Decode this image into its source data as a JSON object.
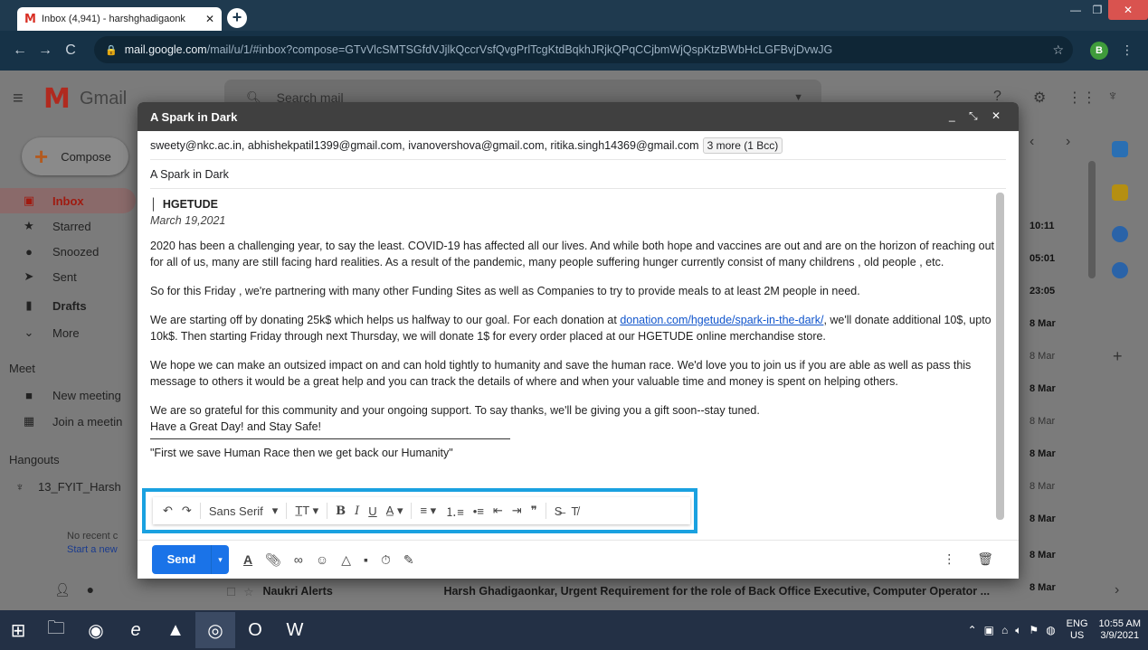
{
  "browser": {
    "tab_title": "Inbox (4,941) - harshghadigaonk",
    "url_host": "mail.google.com",
    "url_path": "/mail/u/1/#inbox?compose=GTvVlcSMTSGfdVJjlkQccrVsfQvgPrlTcgKtdBqkhJRjkQPqCCjbmWjQspKtzBWbHcLGFBvjDvwJG",
    "profile_initial": "B"
  },
  "gmail": {
    "product": "Gmail",
    "search_placeholder": "Search mail",
    "compose_label": "Compose",
    "nav": [
      {
        "label": "Inbox"
      },
      {
        "label": "Starred"
      },
      {
        "label": "Snoozed"
      },
      {
        "label": "Sent"
      },
      {
        "label": "Drafts"
      },
      {
        "label": "More"
      }
    ],
    "meet_heading": "Meet",
    "meet_items": [
      {
        "label": "New meeting"
      },
      {
        "label": "Join a meetin"
      }
    ],
    "hangouts_heading": "Hangouts",
    "hangout_user": "13_FYIT_Harsh",
    "no_recent": "No recent c",
    "start_new": "Start a new",
    "times": [
      "10:11",
      "05:01",
      "23:05",
      "8 Mar",
      "8 Mar",
      "8 Mar",
      "8 Mar",
      "8 Mar",
      "8 Mar",
      "8 Mar",
      "8 Mar",
      "8 Mar"
    ],
    "bottom_row": {
      "sender": "Naukri Alerts",
      "subject": "Harsh Ghadigaonkar, Urgent Requirement for the role of Back Office Executive, Computer Operator ..."
    }
  },
  "compose": {
    "title": "A Spark in Dark",
    "recipients": "sweety@nkc.ac.in, abhishekpatil1399@gmail.com, ivanovershova@gmail.com, ritika.singh14369@gmail.com",
    "more_recipients": "3 more (1 Bcc)",
    "subject": "A Spark in Dark",
    "body": {
      "brand": "HGETUDE",
      "date": "March 19,2021",
      "p1": "2020 has been a challenging year, to say the least. COVID-19 has affected all our lives. And while both hope and vaccines are out and are on the horizon of reaching out for all of us, many are still facing hard realities. As a result of the pandemic, many people suffering hunger currently consist of many childrens , old people , etc.",
      "p2": "So for this Friday , we're partnering with many other Funding Sites as well as Companies to try to provide meals to at least 2M people in need.",
      "p3_before": "We are starting off by donating 25k$ which helps us halfway to our goal. For each donation at ",
      "p3_link": "donation.com/hgetude/spark-in-the-dark/",
      "p3_after": ", we'll donate additional 10$, upto 10k$. Then starting Friday through next Thursday, we will donate 1$ for every order placed at our HGETUDE online merchandise store.",
      "p4": "We hope we can make an outsized impact on and can hold tightly to humanity and save the human race. We'd love you to join us if you are able as well as pass this message to others it would be a great help and you can track the details of where and when your valuable time and money is spent on helping others.",
      "p5a": "We are so grateful for this community and your ongoing support. To say thanks, we'll be giving you a gift soon--stay tuned.",
      "p5b": "Have a Great Day! and Stay Safe!",
      "quote": "\"First we save Human Race then we get back our Humanity\""
    },
    "toolbar_font": "Sans Serif",
    "send_label": "Send"
  },
  "taskbar": {
    "lang_top": "ENG",
    "lang_bottom": "US",
    "time": "10:55 AM",
    "date": "3/9/2021"
  },
  "colors": {
    "accent_highlight": "#1aa1e0",
    "send_blue": "#1a73e8",
    "link": "#1155cc"
  }
}
